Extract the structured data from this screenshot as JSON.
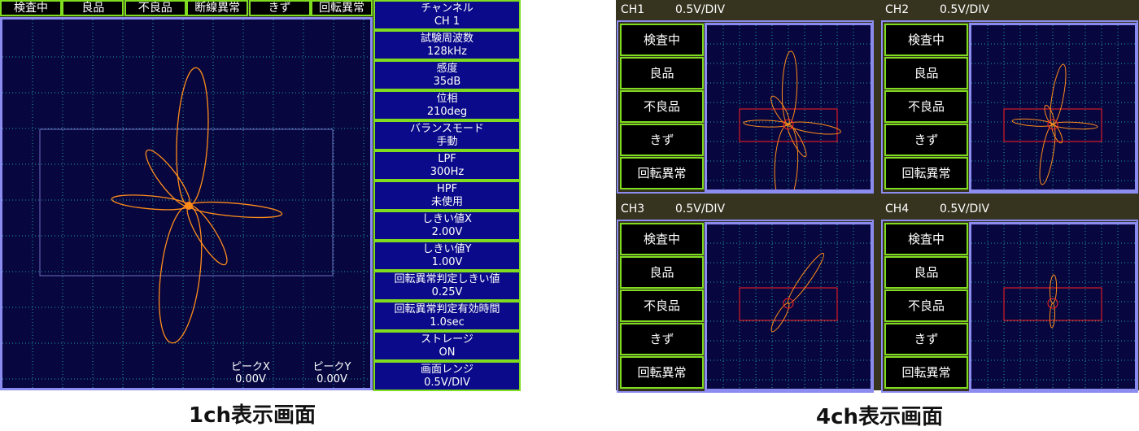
{
  "single": {
    "status": [
      "検査中",
      "良品",
      "不良品",
      "断線異常",
      "きず",
      "回転異常"
    ],
    "settings": [
      {
        "label": "チャンネル",
        "value": "CH 1"
      },
      {
        "label": "試験周波数",
        "value": "128kHz"
      },
      {
        "label": "感度",
        "value": "35dB"
      },
      {
        "label": "位相",
        "value": "210deg"
      },
      {
        "label": "バランスモード",
        "value": "手動"
      },
      {
        "label": "LPF",
        "value": "300Hz"
      },
      {
        "label": "HPF",
        "value": "未使用"
      },
      {
        "label": "しきい値X",
        "value": "2.00V"
      },
      {
        "label": "しきい値Y",
        "value": "1.00V"
      },
      {
        "label": "回転異常判定しきい値",
        "value": "0.25V"
      },
      {
        "label": "回転異常判定有効時間",
        "value": "1.0sec"
      },
      {
        "label": "ストレージ",
        "value": "ON"
      },
      {
        "label": "画面レンジ",
        "value": "0.5V/DIV"
      }
    ],
    "peak_x": {
      "label": "ピークX",
      "value": "0.00V"
    },
    "peak_y": {
      "label": "ピークY",
      "value": "0.00V"
    },
    "caption": "1ch表示画面"
  },
  "quad": {
    "channels": [
      {
        "name": "CH1",
        "range": "0.5V/DIV"
      },
      {
        "name": "CH2",
        "range": "0.5V/DIV"
      },
      {
        "name": "CH3",
        "range": "0.5V/DIV"
      },
      {
        "name": "CH4",
        "range": "0.5V/DIV"
      }
    ],
    "buttons": [
      "検査中",
      "良品",
      "不良品",
      "きず",
      "回転異常"
    ],
    "caption": "4ch表示画面"
  },
  "colors": {
    "trace": "#ff8c1a",
    "threshold": "#ff2020",
    "border": "#7fdc1e",
    "plot_bg": "#07063f"
  }
}
